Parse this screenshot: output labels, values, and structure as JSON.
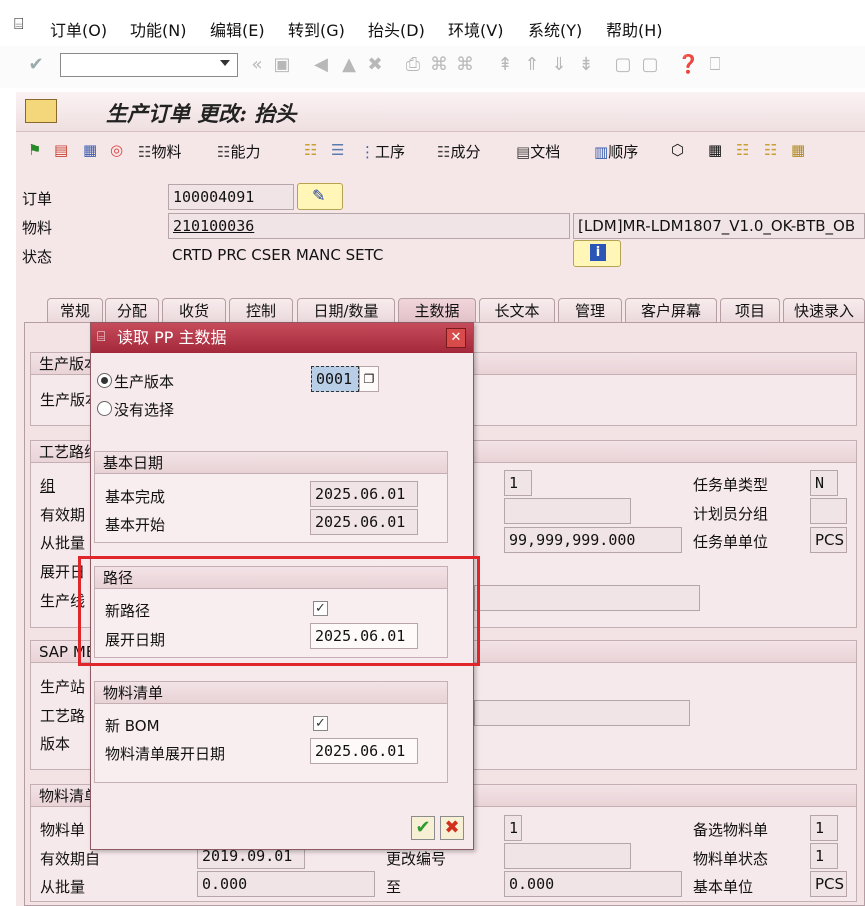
{
  "menu": {
    "items": [
      "订单(O)",
      "功能(N)",
      "编辑(E)",
      "转到(G)",
      "抬头(D)",
      "环境(V)",
      "系统(Y)",
      "帮助(H)"
    ]
  },
  "toolbar": {
    "command_value": ""
  },
  "app": {
    "title": "生产订单 更改: 抬头",
    "toolbar": {
      "material": "物料",
      "capacity": "能力",
      "operation": "工序",
      "component": "成分",
      "document": "文档",
      "sequence": "顺序"
    }
  },
  "header": {
    "order_label": "订单",
    "order_value": "100004091",
    "material_label": "物料",
    "material_value": "210100036",
    "material_desc": "[LDM]MR-LDM1807_V1.0_OK-BTB_OB",
    "status_label": "状态",
    "status_value": "CRTD PRC  CSER MANC SETC"
  },
  "tabs": [
    "常规",
    "分配",
    "收货",
    "控制",
    "日期/数量",
    "主数据",
    "长文本",
    "管理",
    "客户屏幕",
    "项目",
    "快速录入"
  ],
  "panel": {
    "grp1_title": "生产版本",
    "grp1_label": "生产版本",
    "grp2_title": "工艺路线",
    "grp2_group": "组",
    "grp2_valid": "有效期",
    "grp2_from_lot": "从批量",
    "grp2_expl": "展开日",
    "grp2_prodline": "生产线",
    "grp2_counter_value": "1",
    "grp2_lot_to_value": "99,999,999.000",
    "task_list_type_label": "任务单类型",
    "task_list_type_value": "N",
    "planner_group_label": "计划员分组",
    "task_list_unit_label": "任务单单位",
    "task_list_unit_value": "PCS",
    "grp3_title": "SAP ME",
    "grp3_site": "生产站",
    "grp3_routing": "工艺路",
    "grp3_version": "版本",
    "grp4_title": "物料清单",
    "grp4_bom": "物料单",
    "grp4_valid_label": "有效期自",
    "grp4_valid_value": "2019.09.01",
    "grp4_change_no": "更改编号",
    "grp4_from_lot": "从批量",
    "grp4_from_lot_value": "0.000",
    "grp4_to": "至",
    "grp4_to_value": "0.000",
    "grp4_counter_value": "1",
    "alt_bom_label": "备选物料单",
    "alt_bom_value": "1",
    "bom_status_label": "物料单状态",
    "bom_status_value": "1",
    "base_unit_label": "基本单位",
    "base_unit_value": "PCS"
  },
  "dialog": {
    "title": "读取 PP 主数据",
    "radio_prod_version": "生产版本",
    "prod_version_value": "0001",
    "radio_no_select": "没有选择",
    "basic_dates_title": "基本日期",
    "basic_finish_label": "基本完成",
    "basic_finish_value": "2025.06.01",
    "basic_start_label": "基本开始",
    "basic_start_value": "2025.06.01",
    "routing_title": "路径",
    "new_routing_label": "新路径",
    "routing_expl_label": "展开日期",
    "routing_expl_value": "2025.06.01",
    "bom_title": "物料清单",
    "new_bom_label": "新 BOM",
    "bom_expl_label": "物料清单展开日期",
    "bom_expl_value": "2025.06.01"
  },
  "colors": {
    "dialog_title": "#b23345",
    "highlight": "#e0262b",
    "panel_bg": "#f3e3e5"
  }
}
